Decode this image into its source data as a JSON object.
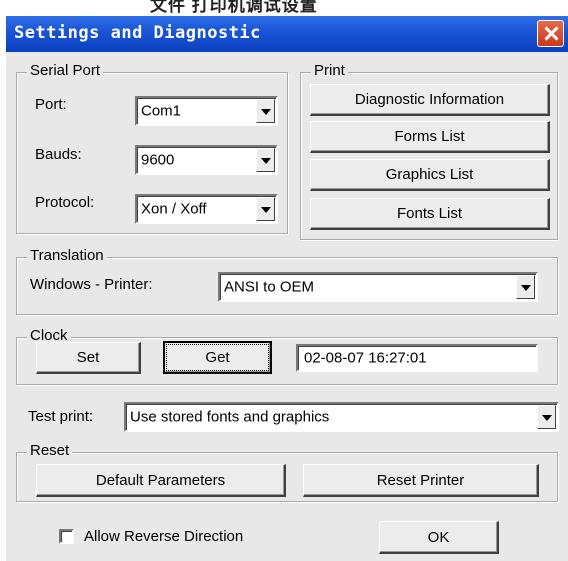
{
  "backdrop": {
    "text": "文件  打印机调试设置"
  },
  "window": {
    "title": "Settings and Diagnostic"
  },
  "serial_port": {
    "legend": "Serial Port",
    "port_label": "Port:",
    "port_value": "Com1",
    "bauds_label": "Bauds:",
    "bauds_value": "9600",
    "protocol_label": "Protocol:",
    "protocol_value": "Xon / Xoff"
  },
  "print": {
    "legend": "Print",
    "buttons": [
      "Diagnostic Information",
      "Forms List",
      "Graphics List",
      "Fonts List"
    ]
  },
  "translation": {
    "legend": "Translation",
    "label": "Windows - Printer:",
    "value": "ANSI to OEM"
  },
  "clock": {
    "legend": "Clock",
    "set_label": "Set",
    "get_label": "Get",
    "datetime": "02-08-07 16:27:01"
  },
  "test_print": {
    "label": "Test print:",
    "value": "Use stored fonts and graphics"
  },
  "reset": {
    "legend": "Reset",
    "default_label": "Default Parameters",
    "printer_label": "Reset Printer"
  },
  "reverse": {
    "label": "Allow Reverse Direction",
    "checked": false
  },
  "ok_label": "OK"
}
